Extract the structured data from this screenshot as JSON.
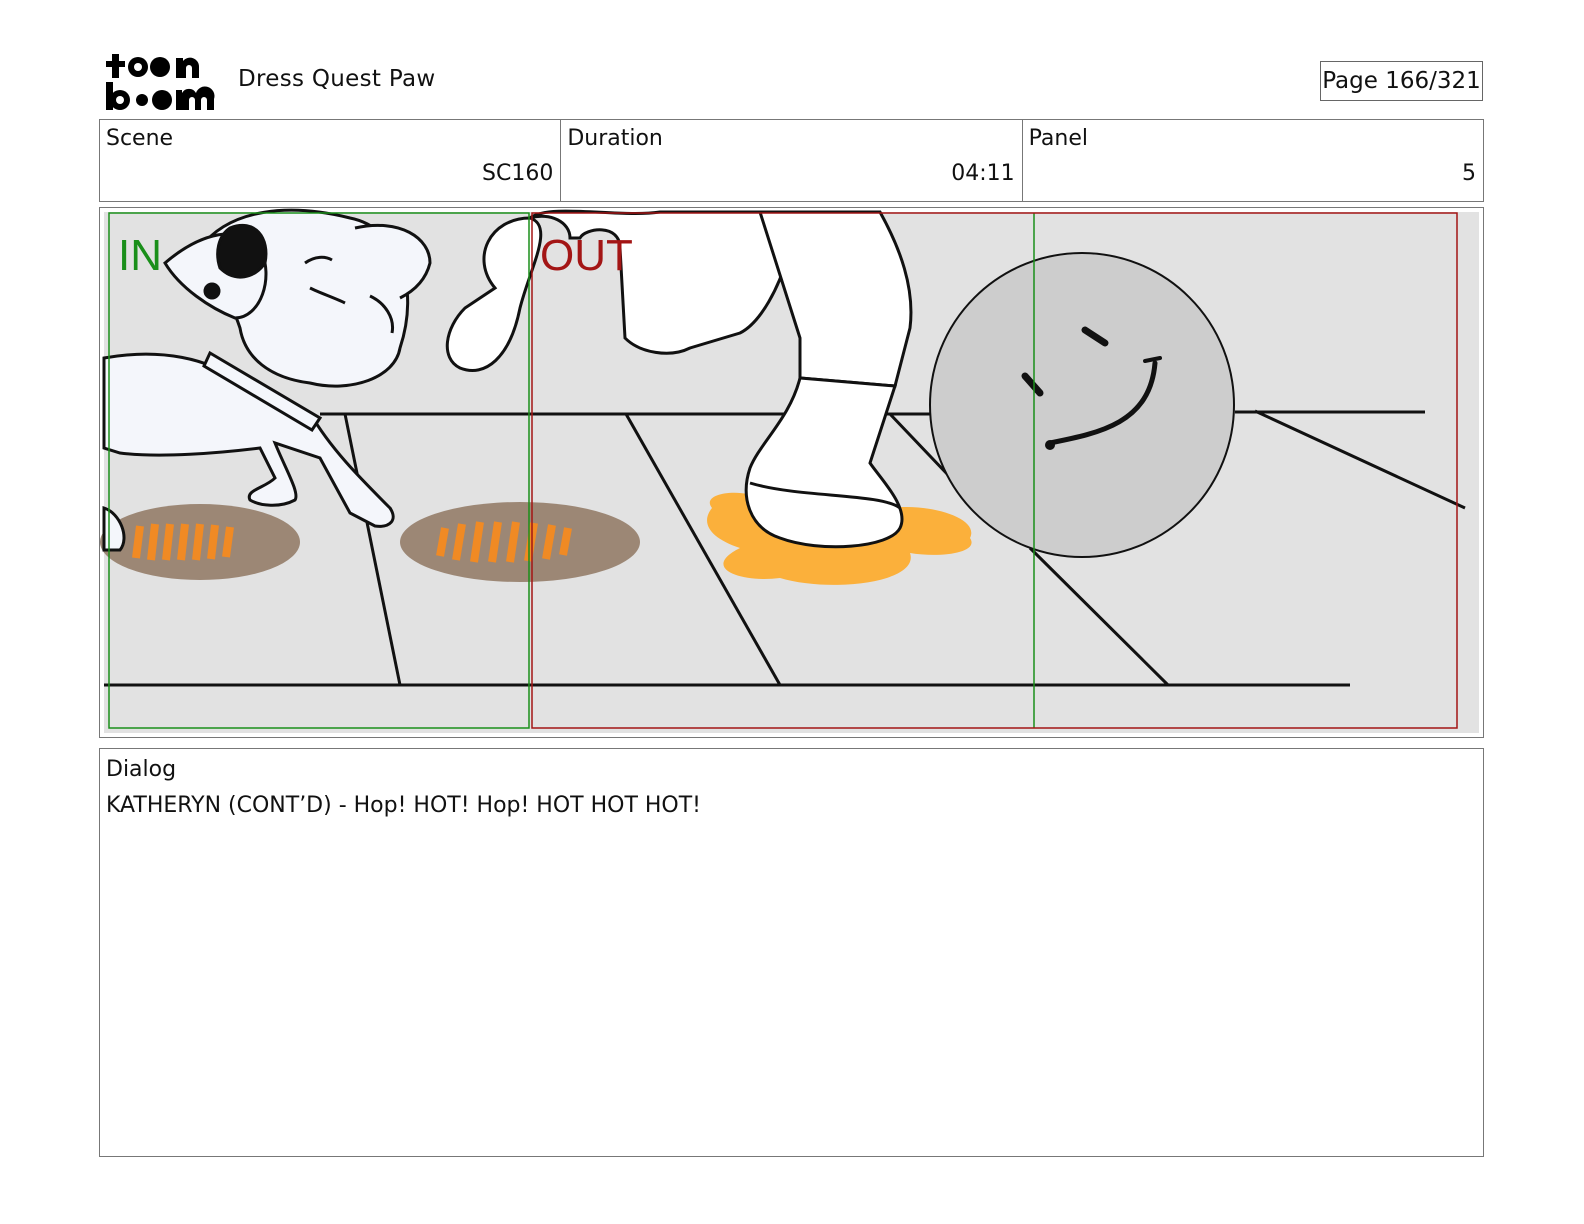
{
  "header": {
    "logo_text": "toon boom",
    "project_title": "Dress Quest Paw",
    "page_indicator": "Page 166/321"
  },
  "info": {
    "scene": {
      "label": "Scene",
      "value": "SC160"
    },
    "duration": {
      "label": "Duration",
      "value": "04:11"
    },
    "panel": {
      "label": "Panel",
      "value": "5"
    }
  },
  "frame": {
    "in_label": "IN",
    "out_label": "OUT",
    "in_color": "#1a8f1a",
    "out_color": "#a31515"
  },
  "dialog": {
    "label": "Dialog",
    "text": "KATHERYN (CONT’D) - Hop! HOT! Hop! HOT HOT HOT!"
  },
  "colors": {
    "floor": "#e2e2e2",
    "mud": "#9c8775",
    "footprint": "#f08a24",
    "spill": "#fbb03b",
    "ball": "#cdcdcd"
  }
}
